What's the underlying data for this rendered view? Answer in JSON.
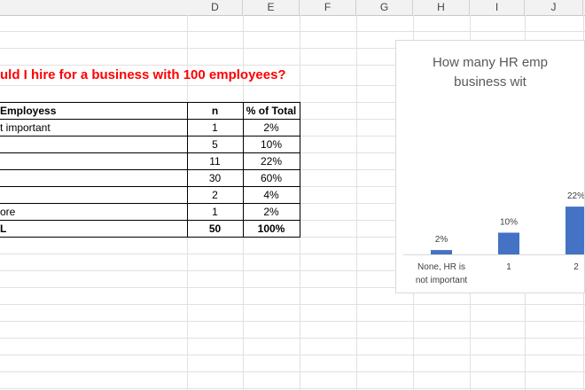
{
  "spreadsheet": {
    "columns": [
      "D",
      "E",
      "F",
      "G",
      "H",
      "I",
      "J"
    ],
    "title": "uld I hire for a business with 100 employees?",
    "table": {
      "headers": [
        "Employess",
        "n",
        "% of Total"
      ],
      "rows": [
        {
          "label": "t important",
          "n": "1",
          "pct": "2%"
        },
        {
          "label": "",
          "n": "5",
          "pct": "10%"
        },
        {
          "label": "",
          "n": "11",
          "pct": "22%"
        },
        {
          "label": "",
          "n": "30",
          "pct": "60%"
        },
        {
          "label": "",
          "n": "2",
          "pct": "4%"
        },
        {
          "label": "ore",
          "n": "1",
          "pct": "2%"
        }
      ],
      "total": {
        "label": "L",
        "n": "50",
        "pct": "100%"
      }
    }
  },
  "chart_data": {
    "type": "bar",
    "title_lines": [
      "How many HR emp",
      "business wit"
    ],
    "categories": [
      [
        "None, HR is",
        "not important"
      ],
      [
        "1"
      ],
      [
        "2"
      ]
    ],
    "values": [
      2,
      10,
      22
    ],
    "data_labels": [
      "2%",
      "10%",
      "22%"
    ],
    "bar_color": "#4472c4",
    "grid": false
  }
}
